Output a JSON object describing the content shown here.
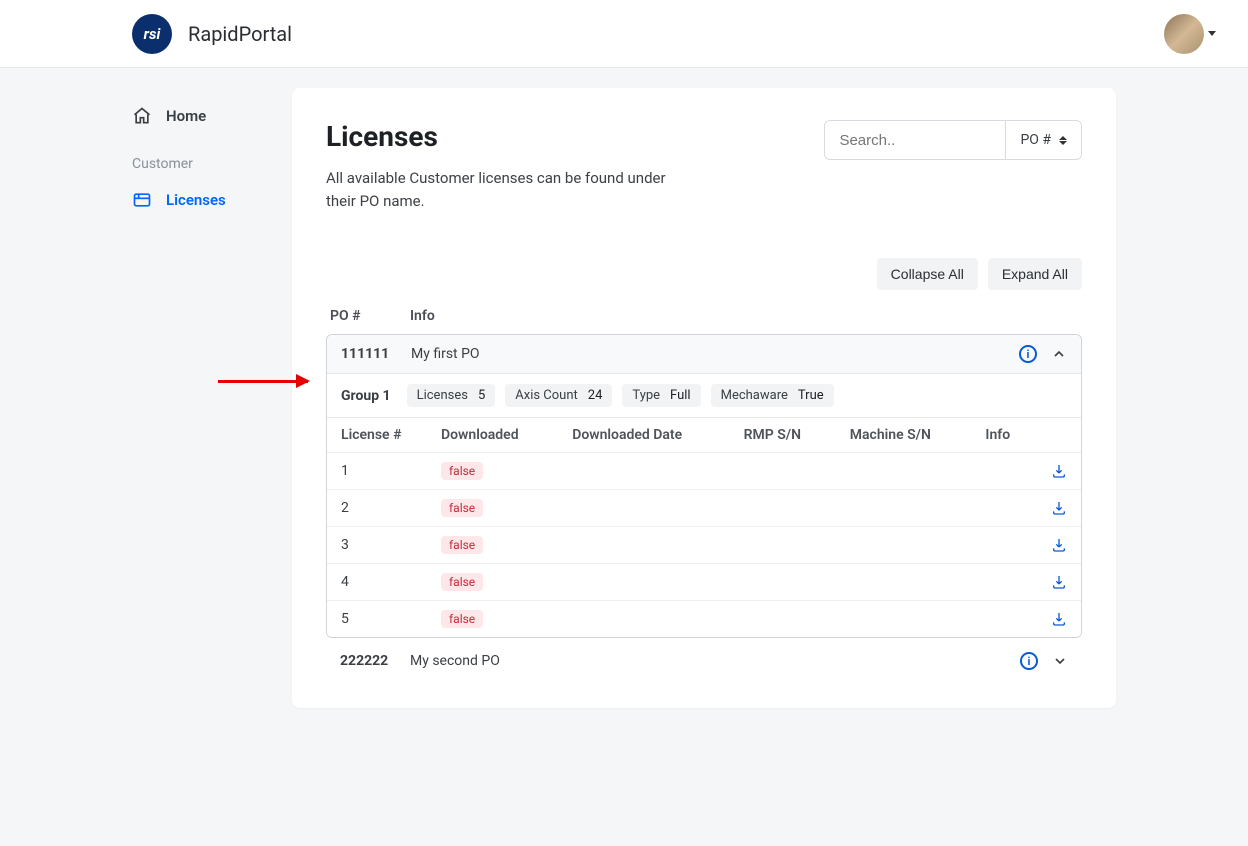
{
  "header": {
    "brand_text": "rsi",
    "brand_name": "RapidPortal"
  },
  "sidebar": {
    "home_label": "Home",
    "section_label": "Customer",
    "licenses_label": "Licenses"
  },
  "main": {
    "title": "Licenses",
    "subtitle": "All available Customer licenses can be found under their PO name.",
    "search_placeholder": "Search..",
    "filter_label": "PO #",
    "collapse_label": "Collapse All",
    "expand_label": "Expand All",
    "col_po": "PO #",
    "col_info": "Info"
  },
  "po1": {
    "number": "111111",
    "info": "My first PO",
    "group_name": "Group 1",
    "tags": {
      "t1_label": "Licenses",
      "t1_val": "5",
      "t2_label": "Axis Count",
      "t2_val": "24",
      "t3_label": "Type",
      "t3_val": "Full",
      "t4_label": "Mechaware",
      "t4_val": "True"
    },
    "th": {
      "c1": "License #",
      "c2": "Downloaded",
      "c3": "Downloaded Date",
      "c4": "RMP S/N",
      "c5": "Machine S/N",
      "c6": "Info"
    },
    "rows": {
      "r1_num": "1",
      "r1_dl": "false",
      "r2_num": "2",
      "r2_dl": "false",
      "r3_num": "3",
      "r3_dl": "false",
      "r4_num": "4",
      "r4_dl": "false",
      "r5_num": "5",
      "r5_dl": "false"
    }
  },
  "po2": {
    "number": "222222",
    "info": "My second PO"
  }
}
